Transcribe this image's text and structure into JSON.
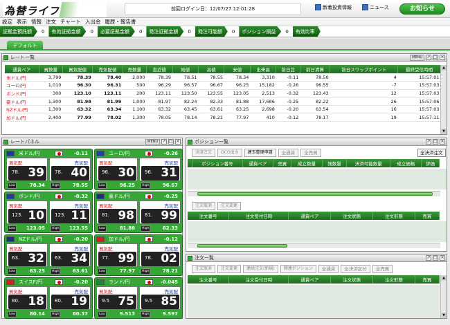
{
  "app": {
    "logo": "為替ライフ",
    "last_login": "前回ログイン日：12/07/27 12:01:28",
    "news_links": [
      "新着投資情報",
      "ニュース"
    ],
    "notice_button": "お知らせ"
  },
  "menu": [
    "設定",
    "表示",
    "情報",
    "注文",
    "チャート",
    "入出金",
    "履歴・報告書"
  ],
  "summary": [
    {
      "label": "証拠金預託額",
      "value": "0"
    },
    {
      "label": "有効証拠金額",
      "value": "0"
    },
    {
      "label": "必要証拠金額",
      "value": "0"
    },
    {
      "label": "発注証拠金額",
      "value": "0"
    },
    {
      "label": "発注可能額",
      "value": "0"
    },
    {
      "label": "ポジション損益",
      "value": "0"
    },
    {
      "label": "有効比率",
      "value": ""
    }
  ],
  "tabs": [
    "デフォルト"
  ],
  "rate_list": {
    "title": "レート一覧",
    "menu_label": "MENU",
    "columns": [
      "通貨ペア",
      "買数量",
      "買気配値",
      "売気配値",
      "売数量",
      "直近値",
      "始値",
      "高値",
      "安値",
      "出来高",
      "前日比",
      "前日清算",
      "前日スワップポイント",
      "最終受信時間"
    ],
    "rows": [
      [
        "米ドル/円",
        "3,799",
        "78.39",
        "78.40",
        "2,000",
        "78.39",
        "78.51",
        "78.55",
        "78.34",
        "3,310",
        "-0.11",
        "78.50",
        "4",
        "15:57:01"
      ],
      [
        "ユーロ/円",
        "1,010",
        "96.30",
        "96.31",
        "500",
        "96.29",
        "96.57",
        "96.67",
        "96.25",
        "15,182",
        "-0.26",
        "96.55",
        "-7",
        "15:57:03"
      ],
      [
        "ポンド/円",
        "300",
        "123.10",
        "123.11",
        "200",
        "123.11",
        "123.50",
        "123.55",
        "123.05",
        "2,513",
        "-0.32",
        "123.43",
        "12",
        "15:57:03"
      ],
      [
        "豪ドル/円",
        "1,300",
        "81.98",
        "81.99",
        "1,000",
        "81.97",
        "82.24",
        "82.33",
        "81.88",
        "17,686",
        "-0.25",
        "82.22",
        "26",
        "15:57:06"
      ],
      [
        "NZドル/円",
        "1,300",
        "63.32",
        "63.34",
        "1,100",
        "63.32",
        "63.45",
        "63.61",
        "63.25",
        "2,698",
        "-0.20",
        "63.54",
        "16",
        "15:57:03"
      ],
      [
        "加ドル/円",
        "2,400",
        "77.99",
        "78.02",
        "1,300",
        "78.05",
        "78.14",
        "78.21",
        "77.97",
        "410",
        "-0.12",
        "78.17",
        "19",
        "15:57:11"
      ]
    ]
  },
  "rate_panel": {
    "title": "レートパネル",
    "menu_label": "MENU",
    "sell_label": "買気配",
    "buy_label": "売気配",
    "low_label": "Low",
    "high_label": "High",
    "cards": [
      {
        "pair": "米ドル/円",
        "change": "-0.11",
        "sell_small": "78.",
        "sell_big": "39",
        "buy_small": "78.",
        "buy_big": "40",
        "low": "78.34",
        "high": "78.55",
        "flag": "#1a3a9a"
      },
      {
        "pair": "ユーロ/円",
        "change": "-0.26",
        "sell_small": "96.",
        "sell_big": "30",
        "buy_small": "96.",
        "buy_big": "31",
        "low": "96.25",
        "high": "96.67",
        "flag": "#1f3fb0"
      },
      {
        "pair": "ポンド/円",
        "change": "-0.32",
        "sell_small": "123.",
        "sell_big": "10",
        "buy_small": "123.",
        "buy_big": "11",
        "low": "123.05",
        "high": "123.55",
        "flag": "#2040a0"
      },
      {
        "pair": "豪ドル/円",
        "change": "-0.25",
        "sell_small": "81.",
        "sell_big": "98",
        "buy_small": "81.",
        "buy_big": "99",
        "low": "81.88",
        "high": "82.33",
        "flag": "#1a2f80"
      },
      {
        "pair": "NZドル/円",
        "change": "-0.20",
        "sell_small": "63.",
        "sell_big": "32",
        "buy_small": "63.",
        "buy_big": "34",
        "low": "63.25",
        "high": "63.61",
        "flag": "#1a2f80"
      },
      {
        "pair": "加ドル/円",
        "change": "-0.12",
        "sell_small": "77.",
        "sell_big": "99",
        "buy_small": "78.",
        "buy_big": "02",
        "low": "77.97",
        "high": "78.21",
        "flag": "#d02020"
      },
      {
        "pair": "スイスF/円",
        "change": "-0.20",
        "sell_small": "80.",
        "sell_big": "18",
        "buy_small": "80.",
        "buy_big": "19",
        "low": "80.14",
        "high": "80.37",
        "flag": "#d02020"
      },
      {
        "pair": "ランド/円",
        "change": "-0.045",
        "sell_small": "9.5",
        "sell_big": "75",
        "buy_small": "9.5",
        "buy_big": "85",
        "low": "9.513",
        "high": "9.597",
        "flag": "#1a8a3a"
      }
    ]
  },
  "position_panel": {
    "title": "ポジション一覧",
    "buttons": [
      "決済注文",
      "OCO出力",
      "建玉整理申請"
    ],
    "selects": [
      "全通貨",
      "全売買"
    ],
    "settle_all": "全決済注文",
    "columns": [
      "",
      "ポジション番号",
      "通貨ペア",
      "売買",
      "成立数量",
      "残数量",
      "決済可能数量",
      "成立価格",
      "評価"
    ],
    "order_buttons": [
      "注文取消",
      "注文変更"
    ],
    "order_columns": [
      "注文番号",
      "注文受付日時",
      "通貨ペア",
      "注文状態",
      "注文形態",
      "売買"
    ]
  },
  "order_panel": {
    "title": "注文一覧",
    "buttons": [
      "注文取消",
      "注文変更",
      "連続注文(新規)",
      "関連ポジション"
    ],
    "selects": [
      "全通貨",
      "全決済区分",
      "全売買"
    ],
    "columns": [
      "注文番号",
      "注文受付日時",
      "通貨ペア",
      "注文状態",
      "注文形態",
      "売買"
    ]
  }
}
